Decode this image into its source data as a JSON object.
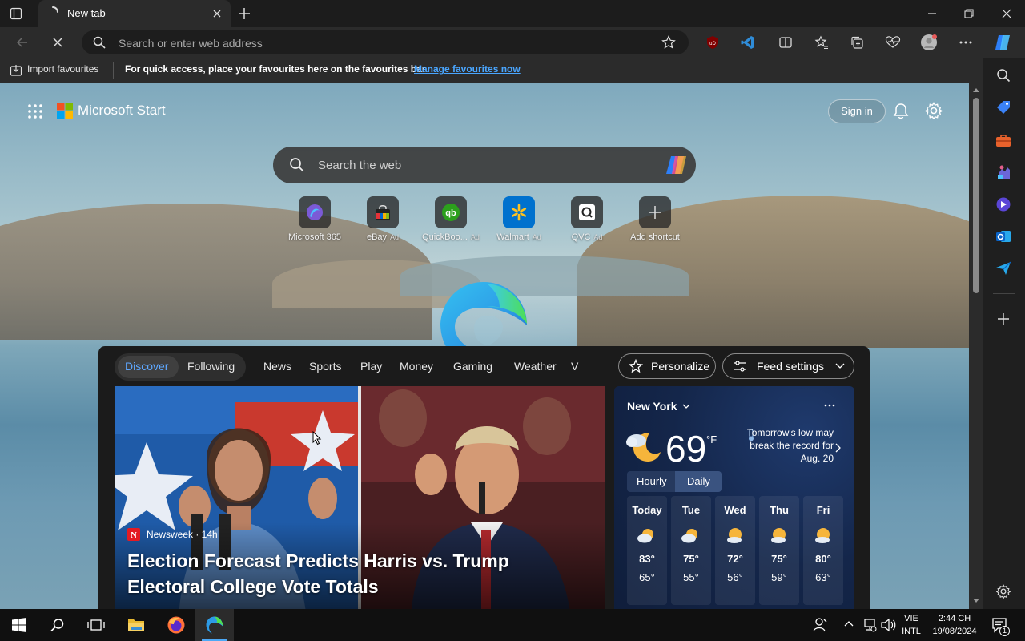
{
  "browser": {
    "tab_title": "New tab",
    "address_placeholder": "Search or enter web address"
  },
  "favourites_bar": {
    "import_label": "Import favourites",
    "message": "For quick access, place your favourites here on the favourites bar.",
    "manage_link": "Manage favourites now"
  },
  "start_page": {
    "brand": "Microsoft Start",
    "sign_in": "Sign in",
    "search_placeholder": "Search the web",
    "shortcuts": [
      {
        "label": "Microsoft 365",
        "ad": ""
      },
      {
        "label": "eBay",
        "ad": "Ad"
      },
      {
        "label": "QuickBoo...",
        "ad": "Ad"
      },
      {
        "label": "Walmart",
        "ad": "Ad"
      },
      {
        "label": "QVC",
        "ad": "Ad"
      },
      {
        "label": "Add shortcut",
        "ad": ""
      }
    ]
  },
  "feed": {
    "tabs": [
      "Discover",
      "Following",
      "News",
      "Sports",
      "Play",
      "Money",
      "Gaming",
      "Weather",
      "V"
    ],
    "personalize": "Personalize",
    "feed_settings": "Feed settings",
    "hero": {
      "source": "Newsweek · 14h",
      "title": "Election Forecast Predicts Harris vs. Trump Electoral College Vote Totals"
    },
    "weather": {
      "city": "New York",
      "temperature": "69",
      "unit": "°F",
      "alert": "Tomorrow's low may break the record for Aug. 20",
      "toggle_hourly": "Hourly",
      "toggle_daily": "Daily",
      "days": [
        {
          "name": "Today",
          "hi": "83°",
          "lo": "65°"
        },
        {
          "name": "Tue",
          "hi": "75°",
          "lo": "55°"
        },
        {
          "name": "Wed",
          "hi": "72°",
          "lo": "56°"
        },
        {
          "name": "Thu",
          "hi": "75°",
          "lo": "59°"
        },
        {
          "name": "Fri",
          "hi": "80°",
          "lo": "63°"
        }
      ]
    }
  },
  "taskbar": {
    "lang_top": "VIE",
    "lang_bottom": "INTL",
    "time": "2:44 CH",
    "date": "19/08/2024",
    "notification_count": "1"
  },
  "colors": {
    "accent_blue": "#5ea7ff",
    "link_blue": "#4aa6ff",
    "feed_bg": "#1b1b1b",
    "weather_bg": "#14264a"
  }
}
